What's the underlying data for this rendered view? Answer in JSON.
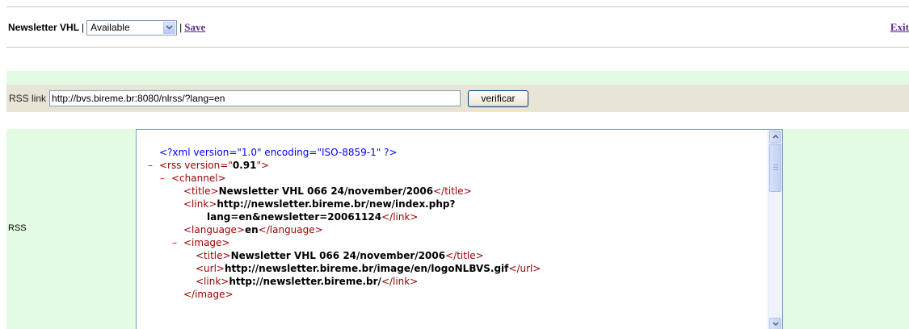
{
  "header": {
    "title": "Newsletter VHL",
    "separator": "|",
    "status_select": {
      "value": "Available"
    },
    "save_label": "Save",
    "exit_label": "Exit"
  },
  "rss_form": {
    "label": "RSS link",
    "url_value": "http://bvs.bireme.br:8080/nlrss/?lang=en",
    "verify_button": "verificar"
  },
  "rss_section": {
    "label": "RSS",
    "xml": {
      "prolog": "<?xml version=\"1.0\" encoding=\"ISO-8859-1\" ?>",
      "rss_open_start": "<rss version=\"",
      "rss_version": "0.91",
      "rss_open_end": "\">",
      "channel_open": "<channel>",
      "title_open": "<title>",
      "channel_title": "Newsletter VHL 066 24/november/2006",
      "title_close": "</title>",
      "link_open": "<link>",
      "channel_link_line1": "http://newsletter.bireme.br/new/index.php?",
      "channel_link_line2": "lang=en&newsletter=20061124",
      "link_close": "</link>",
      "language_open": "<language>",
      "channel_language": "en",
      "language_close": "</language>",
      "image_open": "<image>",
      "image_title": "Newsletter VHL 066 24/november/2006",
      "url_open": "<url>",
      "image_url": "http://newsletter.bireme.br/image/en/logoNLBVS.gif",
      "url_close": "</url>",
      "image_link": "http://newsletter.bireme.br/",
      "image_close": "</image>",
      "collapse_symbol": "–"
    }
  },
  "colors": {
    "page_background": "#ffffff",
    "green_band": "#e3fbe3",
    "beige_band": "#e8e4d6",
    "link": "#5b2c8a",
    "xml_tag": "#990000",
    "xml_prolog": "#0000ff",
    "collapse_marker": "#ff0000"
  },
  "icons": {
    "select_arrow": "chevron-down-icon",
    "scroll_up": "arrow-up-icon",
    "scroll_down": "arrow-down-icon"
  }
}
